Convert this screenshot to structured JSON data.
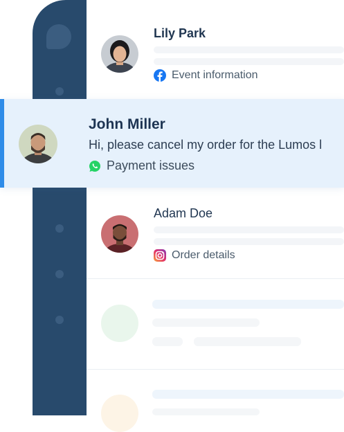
{
  "conversations": [
    {
      "name": "Lily Park",
      "channel": "Event information",
      "channel_icon": "facebook-icon"
    },
    {
      "name": "John Miller",
      "preview": "Hi, please cancel my order for the Lumos l",
      "channel": "Payment issues",
      "channel_icon": "whatsapp-icon",
      "active": true
    },
    {
      "name": "Adam Doe",
      "channel": "Order details",
      "channel_icon": "instagram-icon"
    }
  ],
  "colors": {
    "sidebar": "#284a6c",
    "active_bg": "#e6f1fc",
    "active_accent": "#2f8ce8",
    "facebook": "#1877f2",
    "whatsapp": "#25d366"
  }
}
